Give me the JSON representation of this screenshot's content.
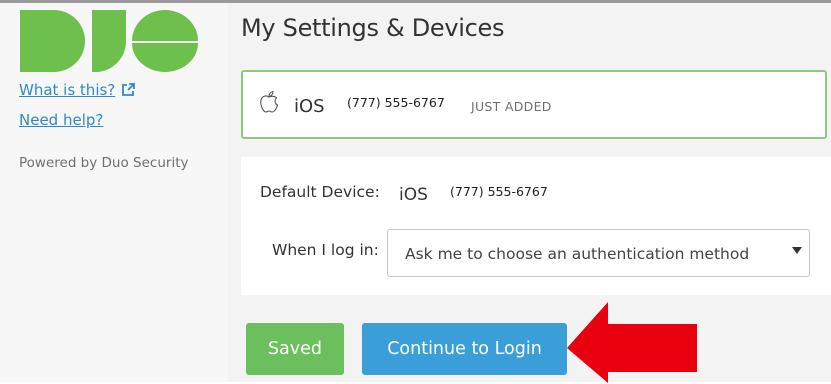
{
  "brand": {
    "logo_text": "DUO",
    "color": "#6dc04b"
  },
  "sidebar": {
    "what_is_this_label": "What is this?",
    "need_help_label": "Need help?",
    "powered_by": "Powered by Duo Security",
    "link_color": "#2d8ac7",
    "external_link_icon": "external-link-icon"
  },
  "main": {
    "title": "My Settings & Devices",
    "device": {
      "icon": "apple-icon",
      "os": "iOS",
      "phone": "(777) 555-6767",
      "status": "JUST ADDED",
      "border_color": "#8cc97e"
    },
    "settings": {
      "default_device_label": "Default Device:",
      "default_device_os": "iOS",
      "default_device_phone": "(777) 555-6767",
      "when_login_label": "When I log in:",
      "when_login_value": "Ask me to choose an authentication method"
    },
    "buttons": {
      "saved_label": "Saved",
      "saved_color": "#6cbf5d",
      "continue_label": "Continue to Login",
      "continue_color": "#3a9fd8"
    },
    "annotation": {
      "icon": "red-arrow-pointer",
      "color": "#e8000f"
    }
  }
}
